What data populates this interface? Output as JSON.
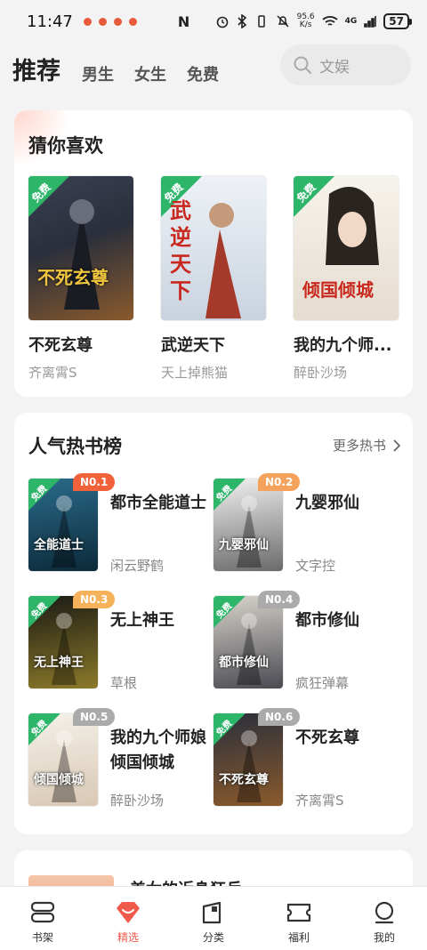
{
  "status": {
    "time": "11:47",
    "speed_value": "95.6",
    "speed_unit": "K/s",
    "net": "4G",
    "battery": "57"
  },
  "header": {
    "tabs": [
      "推荐",
      "男生",
      "女生",
      "免费"
    ],
    "search_placeholder": "文娱"
  },
  "guess": {
    "title": "猜你喜欢",
    "books": [
      {
        "name": "不死玄尊",
        "author": "齐离霄S",
        "badge": "免费",
        "cover_text": "不死玄尊",
        "colors": [
          "#2a2f3c",
          "#8a5a2c"
        ]
      },
      {
        "name": "武逆天下",
        "author": "天上掉熊猫",
        "badge": "免费",
        "cover_text": "武逆天下",
        "colors": [
          "#e9eef2",
          "#a9b6c8"
        ]
      },
      {
        "name": "我的九个师...",
        "author": "醉卧沙场",
        "badge": "免费",
        "cover_text": "倾国倾城",
        "colors": [
          "#f4f1ea",
          "#d9c8b4"
        ]
      }
    ]
  },
  "hot": {
    "title": "人气热书榜",
    "more": "更多热书",
    "items": [
      {
        "rank": "N0.1",
        "name": "都市全能道士",
        "author": "闲云野鹤",
        "rank_color": "#f2623a",
        "colors": [
          "#2a6b8a",
          "#0d2a3a"
        ],
        "cover_text": "全能道士"
      },
      {
        "rank": "N0.2",
        "name": "九婴邪仙",
        "author": "文字控",
        "rank_color": "#f5a35c",
        "colors": [
          "#f2f2f2",
          "#6a6a6a"
        ],
        "cover_text": "九婴邪仙"
      },
      {
        "rank": "N0.3",
        "name": "无上神王",
        "author": "草根",
        "rank_color": "#f5b25a",
        "colors": [
          "#1a1a14",
          "#8c7a2a"
        ],
        "cover_text": "无上神王"
      },
      {
        "rank": "N0.4",
        "name": "都市修仙",
        "author": "疯狂弹幕",
        "rank_color": "#aaaaaa",
        "colors": [
          "#d9d4cc",
          "#4a4a52"
        ],
        "cover_text": "都市修仙"
      },
      {
        "rank": "N0.5",
        "name": "我的九个师娘倾国倾城",
        "author": "醉卧沙场",
        "rank_color": "#aaaaaa",
        "colors": [
          "#f4f1ea",
          "#d9c8b4"
        ],
        "cover_text": "倾国倾城"
      },
      {
        "rank": "N0.6",
        "name": "不死玄尊",
        "author": "齐离霄S",
        "rank_color": "#aaaaaa",
        "colors": [
          "#2a2f3c",
          "#8a5a2c"
        ],
        "cover_text": "不死玄尊"
      }
    ]
  },
  "peek": {
    "title": "美女的近身狂兵"
  },
  "nav": {
    "items": [
      {
        "label": "书架",
        "icon": "bookshelf-icon"
      },
      {
        "label": "精选",
        "icon": "diamond-icon"
      },
      {
        "label": "分类",
        "icon": "category-icon"
      },
      {
        "label": "福利",
        "icon": "ticket-icon"
      },
      {
        "label": "我的",
        "icon": "profile-icon"
      }
    ],
    "active_color": "#ef5a4a"
  }
}
